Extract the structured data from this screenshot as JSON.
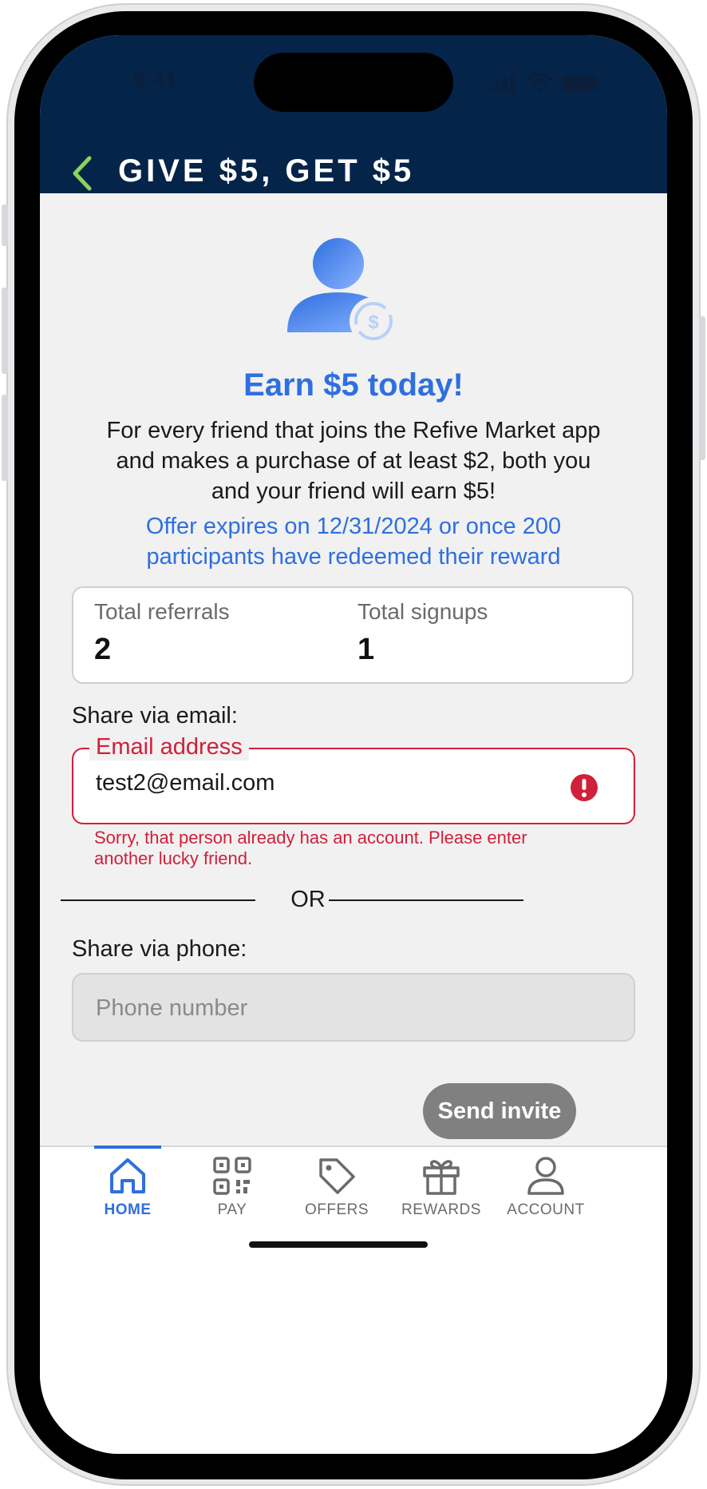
{
  "status_bar": {
    "time": "9:41"
  },
  "header": {
    "title": "GIVE $5, GET $5"
  },
  "hero": {
    "headline": "Earn $5 today!",
    "description": "For every friend that joins the Refive Market app and makes a purchase of at least $2, both you and your friend will earn $5!",
    "expiry_note": "Offer expires on 12/31/2024 or once 200 participants have redeemed their reward"
  },
  "stats": {
    "referrals_label": "Total referrals",
    "referrals_value": "2",
    "signups_label": "Total signups",
    "signups_value": "1"
  },
  "email_share": {
    "section_label": "Share via email:",
    "field_label": "Email address",
    "value": "test2@email.com",
    "error": "Sorry, that person already has an account. Please enter another lucky friend."
  },
  "divider": {
    "text": "OR"
  },
  "phone_share": {
    "section_label": "Share via phone:",
    "placeholder": "Phone number",
    "value": ""
  },
  "send_button": {
    "label": "Send invite"
  },
  "nav": {
    "active": "home",
    "items": [
      {
        "id": "home",
        "label": "HOME",
        "icon": "home-icon"
      },
      {
        "id": "pay",
        "label": "PAY",
        "icon": "qr-code-icon"
      },
      {
        "id": "offers",
        "label": "OFFERS",
        "icon": "tag-icon"
      },
      {
        "id": "rewards",
        "label": "REWARDS",
        "icon": "gift-icon"
      },
      {
        "id": "account",
        "label": "ACCOUNT",
        "icon": "user-icon"
      }
    ]
  },
  "colors": {
    "header_bg": "#05244a",
    "accent_blue": "#2f6fdf",
    "back_arrow": "#8bd45a",
    "error_red": "#d0203a",
    "button_disabled": "#808080"
  }
}
